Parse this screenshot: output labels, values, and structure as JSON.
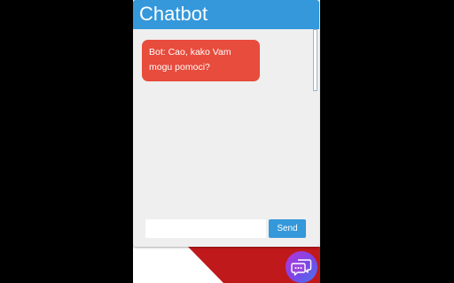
{
  "chatbot": {
    "title": "Chatbot",
    "messages": [
      {
        "sender": "Bot",
        "text": "Bot: Cao, kako Vam mogu pomoci?"
      }
    ],
    "input": {
      "value": "",
      "placeholder": ""
    },
    "send_label": "Send",
    "launcher_icon": "chat-bubbles-icon"
  },
  "colors": {
    "header": "#3498db",
    "bot_bubble": "#e74c3c",
    "send_button": "#3498db",
    "page_accent": "#c0191b",
    "chat_background": "#efefef"
  }
}
